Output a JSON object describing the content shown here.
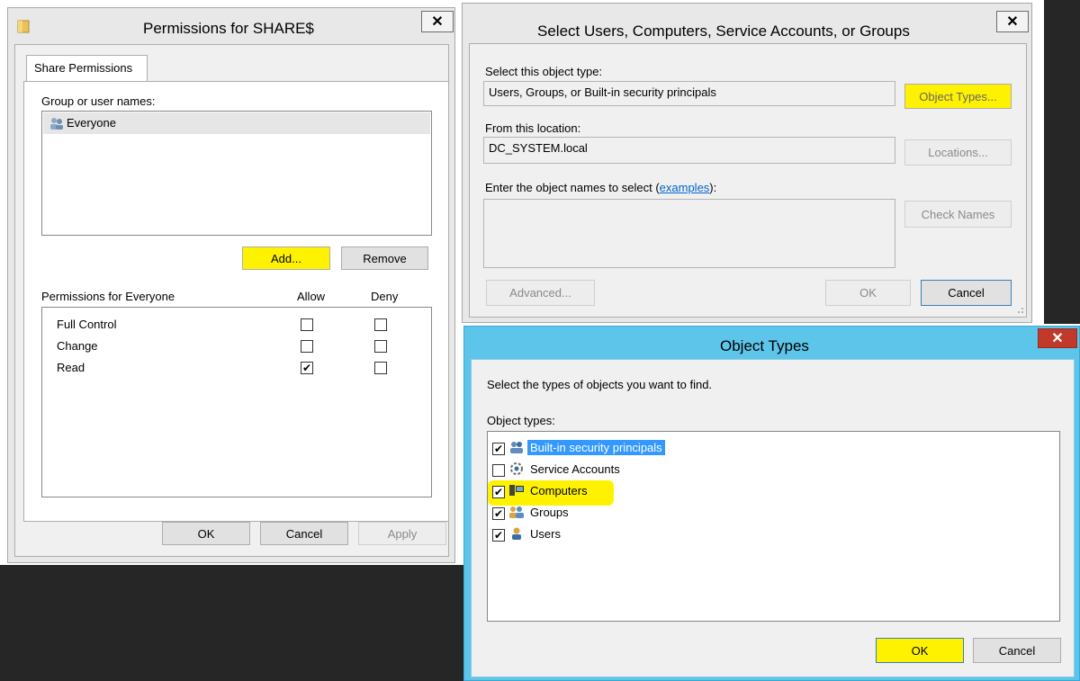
{
  "permissions_dialog": {
    "title": "Permissions for SHARE$",
    "tab": "Share Permissions",
    "group_label": "Group or user names:",
    "users": [
      "Everyone"
    ],
    "add_label": "Add...",
    "remove_label": "Remove",
    "perm_header": "Permissions for Everyone",
    "allow_header": "Allow",
    "deny_header": "Deny",
    "permissions": [
      {
        "name": "Full Control",
        "allow": false,
        "deny": false
      },
      {
        "name": "Change",
        "allow": false,
        "deny": false
      },
      {
        "name": "Read",
        "allow": true,
        "deny": false
      }
    ],
    "ok_label": "OK",
    "cancel_label": "Cancel",
    "apply_label": "Apply"
  },
  "select_dialog": {
    "title": "Select Users, Computers, Service Accounts, or Groups",
    "object_type_label": "Select this object type:",
    "object_type_value": "Users, Groups, or Built-in security principals",
    "object_types_button": "Object Types...",
    "location_label": "From this location:",
    "location_value": "DC_SYSTEM.local",
    "locations_button": "Locations...",
    "enter_label": "Enter the object names to select (",
    "examples_link": "examples",
    "enter_label_end": "):",
    "check_names_button": "Check Names",
    "advanced_button": "Advanced...",
    "ok_label": "OK",
    "cancel_label": "Cancel"
  },
  "object_types_dialog": {
    "title": "Object Types",
    "instruction": "Select the types of objects you want to find.",
    "list_label": "Object types:",
    "items": [
      {
        "label": "Built-in security principals",
        "checked": true,
        "icon": "security-principals-icon"
      },
      {
        "label": "Service Accounts",
        "checked": false,
        "icon": "service-accounts-icon"
      },
      {
        "label": "Computers",
        "checked": true,
        "icon": "computers-icon"
      },
      {
        "label": "Groups",
        "checked": true,
        "icon": "groups-icon"
      },
      {
        "label": "Users",
        "checked": true,
        "icon": "users-icon"
      }
    ],
    "ok_label": "OK",
    "cancel_label": "Cancel"
  },
  "colors": {
    "highlight": "#fff200",
    "selection": "#3399ff",
    "blue_frame": "#5ec5ea",
    "close_red": "#c0392b"
  }
}
